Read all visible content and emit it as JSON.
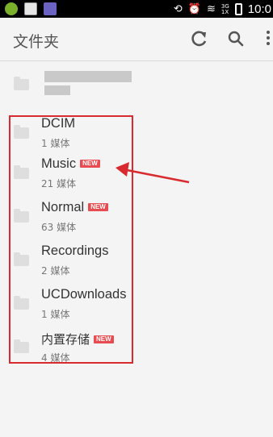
{
  "status_bar": {
    "time": "10:0",
    "icons": [
      "android-icon",
      "image-icon",
      "app-icon",
      "rotate-icon",
      "alarm-icon",
      "wifi-icon",
      "signal-icon",
      "battery-icon"
    ],
    "network_top": "3G",
    "network_bottom": "1X"
  },
  "app_bar": {
    "title": "文件夹",
    "actions": [
      "refresh-icon",
      "search-icon",
      "more-icon"
    ]
  },
  "folders": [
    {
      "name": "DCIM",
      "count": "1 媒体",
      "new": false
    },
    {
      "name": "Music",
      "count": "21 媒体",
      "new": true
    },
    {
      "name": "Normal",
      "count": "63 媒体",
      "new": true
    },
    {
      "name": "Recordings",
      "count": "2 媒体",
      "new": false
    },
    {
      "name": "UCDownloads",
      "count": "1 媒体",
      "new": false
    },
    {
      "name": "内置存储",
      "count": "4 媒体",
      "new": true
    }
  ],
  "badge_label": "NEW",
  "colors": {
    "badge": "#e84c50",
    "annotation": "#d92b2f",
    "folder_icon": "#dedede"
  }
}
